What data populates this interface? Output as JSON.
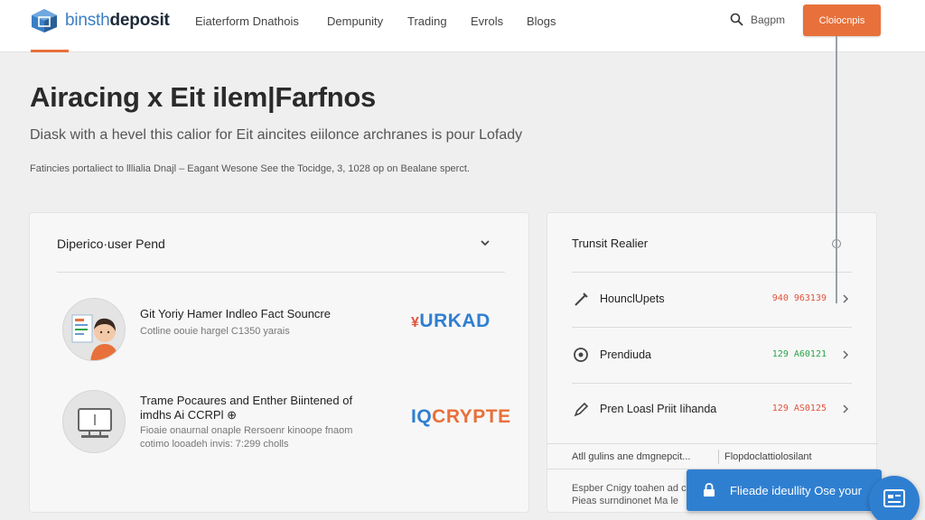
{
  "nav": {
    "logo_part1": "binsth",
    "logo_part2": "deposit",
    "links": [
      "Eiaterform Dnathois",
      "Dempunity",
      "Trading",
      "Evrols",
      "Blogs"
    ],
    "search_label": "Bagpm",
    "cta_label": "Cloiocnpis"
  },
  "hero": {
    "title": "Airacing x Eit ilem|Farfnos",
    "subtitle": "Diask with a hevel this calior for Eit aincites eiilonce archranes is pour Lofady",
    "note": "Fatincies portaliect to lllialia Dnajl – Eagant Wesone See the Tocidge, 3, 1028 op on Bealane sperct."
  },
  "left_card": {
    "heading": "Diperico·user Pend",
    "items": [
      {
        "title_lines": [
          "Git Yoriy Hamer Indleo Fact Souncre"
        ],
        "meta_lines": [
          "Cotline oouie hargel C1350 yarais"
        ],
        "brand": "URKAD",
        "brand_prefix": "¥"
      },
      {
        "title_lines": [
          "Trame Pocaures and Enther Biintened of",
          "imdhs Ai CCRPl ⊕"
        ],
        "meta_lines": [
          "Fioaie onaurnal onaple Rersoenr kinoope fnaom",
          "cotimo looadeh invis: 7:299 cholls"
        ],
        "brand": "CRYPTE",
        "brand_prefix": "IQ"
      }
    ]
  },
  "right_card": {
    "heading": "Trunsit Realier",
    "rows": [
      {
        "icon": "pencil-icon",
        "label": "HounclUpets",
        "value": "940 963139",
        "value_color": "#e0533c"
      },
      {
        "icon": "location-pin-icon",
        "label": "Prendiuda",
        "value": "129 A60121",
        "value_color": "#2aa44a"
      },
      {
        "icon": "pen-icon",
        "label": "Pren Loasl Priit Iihanda",
        "value": "129 AS0125",
        "value_color": "#e0533c"
      }
    ],
    "footer_left": "Atll gulins ane dmgnepcit...",
    "footer_right": "Flopdoclattiolosilant",
    "footer_bottom": [
      "Espber Cnigy toahen ad cl",
      "Pieas surndinonet Ma le"
    ]
  },
  "toast": {
    "label": "Flieade ideullity Ose your"
  },
  "colors": {
    "accent": "#e8703a",
    "primary_blue": "#2f7fd1",
    "positive": "#2aa44a",
    "negative": "#e0533c"
  }
}
